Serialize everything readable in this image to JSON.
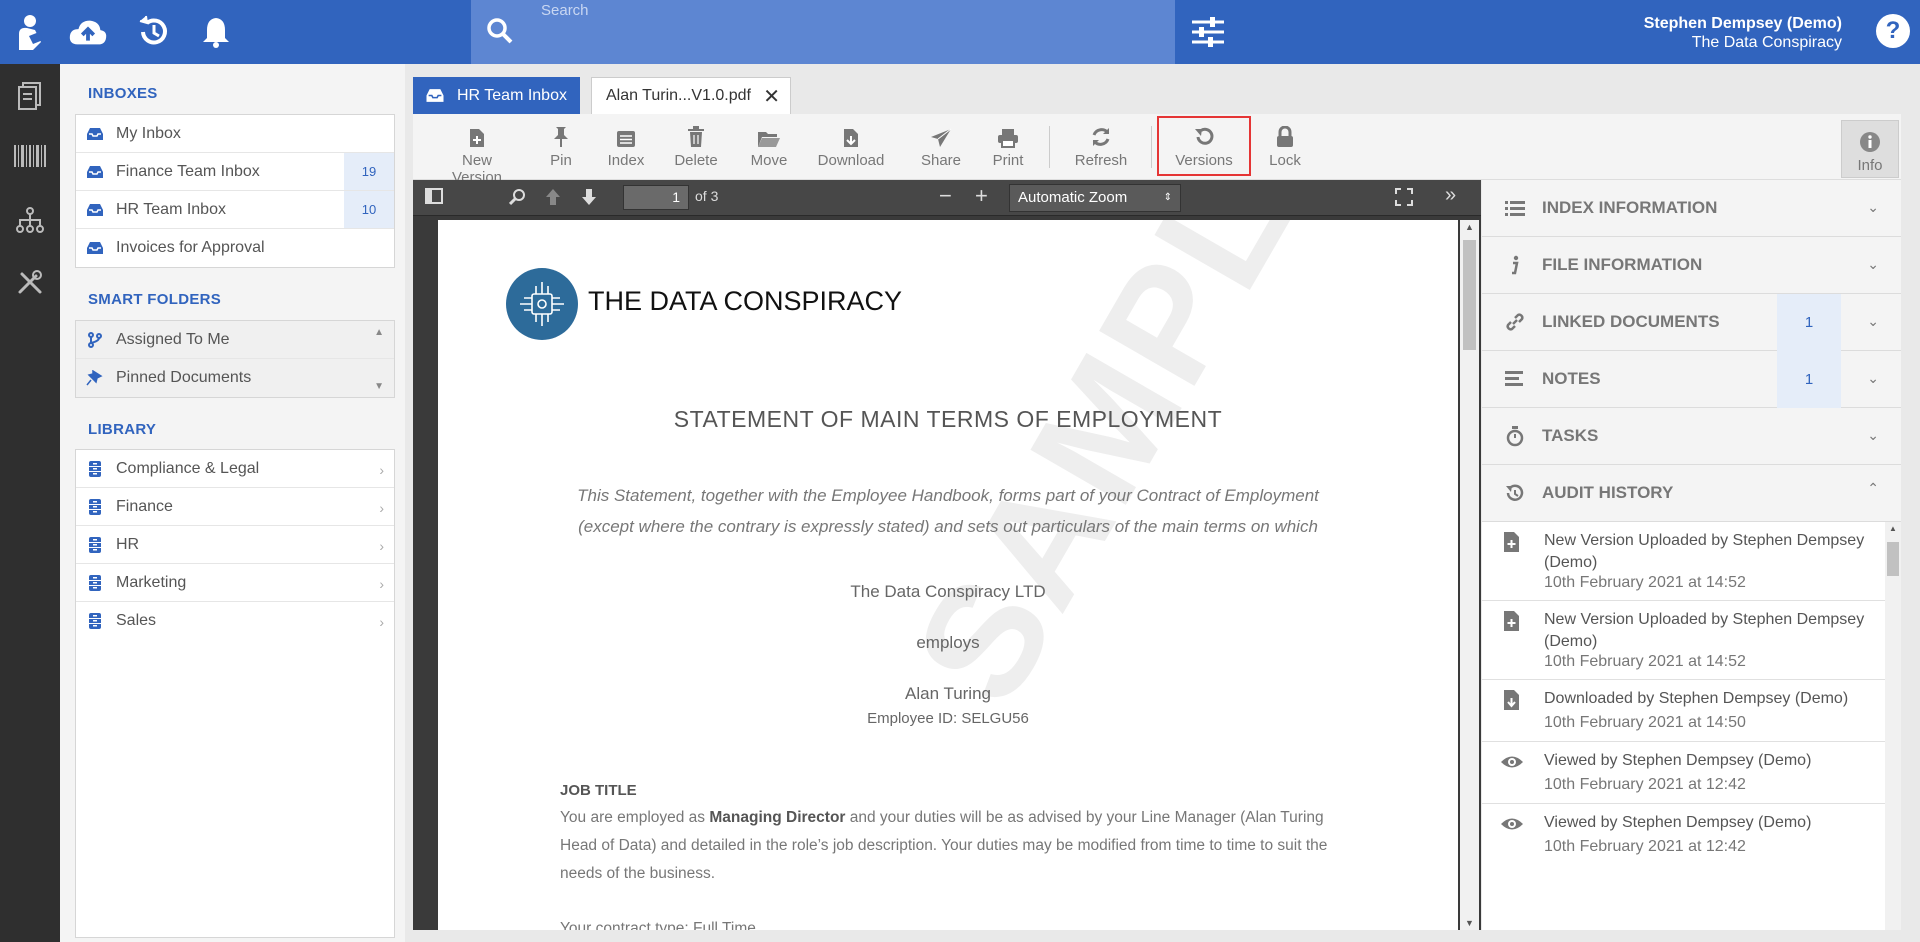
{
  "header": {
    "search_placeholder": "Search",
    "user_name": "Stephen Dempsey (Demo)",
    "organization": "The Data Conspiracy",
    "help_label": "?"
  },
  "sidebar": {
    "inboxes_title": "INBOXES",
    "inboxes": [
      {
        "label": "My Inbox",
        "count": ""
      },
      {
        "label": "Finance Team Inbox",
        "count": "19"
      },
      {
        "label": "HR Team Inbox",
        "count": "10"
      },
      {
        "label": "Invoices for Approval",
        "count": ""
      }
    ],
    "smart_folders_title": "SMART FOLDERS",
    "smart_folders": [
      {
        "label": "Assigned To Me"
      },
      {
        "label": "Pinned Documents"
      }
    ],
    "library_title": "LIBRARY",
    "library": [
      {
        "label": "Compliance & Legal"
      },
      {
        "label": "Finance"
      },
      {
        "label": "HR"
      },
      {
        "label": "Marketing"
      },
      {
        "label": "Sales"
      }
    ]
  },
  "tabs": [
    {
      "label": "HR Team Inbox"
    },
    {
      "label": "Alan Turin...V1.0.pdf"
    }
  ],
  "toolbar": {
    "new_version": "New Version",
    "pin": "Pin",
    "index": "Index",
    "delete": "Delete",
    "move": "Move",
    "download": "Download",
    "share": "Share",
    "print": "Print",
    "refresh": "Refresh",
    "versions": "Versions",
    "lock": "Lock",
    "info": "Info"
  },
  "viewer": {
    "page_number": "1",
    "page_total": "of 3",
    "zoom": "Automatic Zoom"
  },
  "document": {
    "company": "THE DATA CONSPIRACY",
    "title": "STATEMENT OF MAIN TERMS OF EMPLOYMENT",
    "intro": "This Statement, together with the Employee Handbook, forms part of your Contract of Employment (except where the contrary is expressly stated) and sets out particulars of the main terms on which",
    "employer": "The Data Conspiracy LTD",
    "employs": "employs",
    "employee": "Alan Turing",
    "employee_id": "Employee ID: SELGU56",
    "job_title_heading": "JOB TITLE",
    "job_pre": "You are employed as ",
    "job_role": "Managing Director",
    "job_post": " and your duties will be as advised by your Line Manager (Alan Turing Head of Data) and detailed in the role’s job description. Your duties may be modified from time to time to suit the needs of the business.",
    "contract_type": "Your contract type: Full Time",
    "watermark": "SAMPLE DATA"
  },
  "right_panel": {
    "sections": [
      {
        "title": "INDEX INFORMATION",
        "count": ""
      },
      {
        "title": "FILE INFORMATION",
        "count": ""
      },
      {
        "title": "LINKED DOCUMENTS",
        "count": "1"
      },
      {
        "title": "NOTES",
        "count": "1"
      },
      {
        "title": "TASKS",
        "count": ""
      },
      {
        "title": "AUDIT HISTORY",
        "count": ""
      }
    ],
    "audit": [
      {
        "text": "New Version Uploaded by Stephen Dempsey (Demo)",
        "date": "10th February 2021 at 14:52",
        "icon": "file-plus-icon"
      },
      {
        "text": "New Version Uploaded by Stephen Dempsey (Demo)",
        "date": "10th February 2021 at 14:52",
        "icon": "file-plus-icon"
      },
      {
        "text": "Downloaded by Stephen Dempsey (Demo)",
        "date": "10th February 2021 at 14:50",
        "icon": "file-download-icon"
      },
      {
        "text": "Viewed by Stephen Dempsey (Demo)",
        "date": "10th February 2021 at 12:42",
        "icon": "eye-icon"
      },
      {
        "text": "Viewed by Stephen Dempsey (Demo)",
        "date": "10th February 2021 at 12:42",
        "icon": "eye-icon"
      }
    ]
  },
  "colors": {
    "brand_blue": "#3164be",
    "search_blue": "#5d86d2",
    "rail_dark": "#2f2f2f",
    "highlight_red": "#e53535",
    "count_bg": "#e5edf9"
  }
}
